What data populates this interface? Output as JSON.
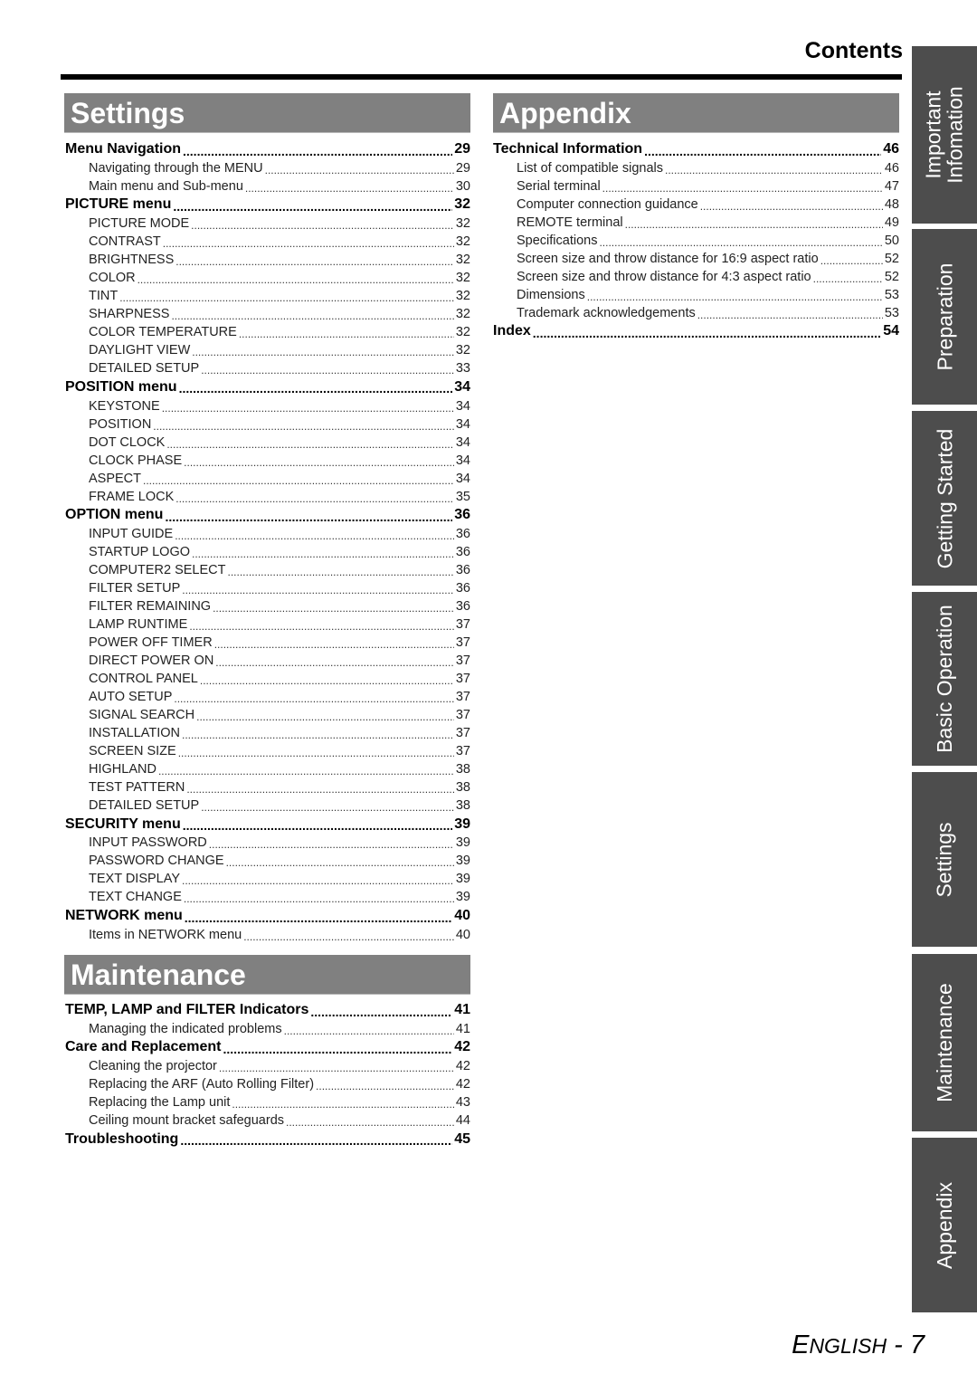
{
  "page": {
    "contents_title": "Contents",
    "footer_lang": "ENGLISH",
    "footer_lang_first": "E",
    "footer_lang_rest": "NGLISH",
    "footer_sep": " - ",
    "footer_page": "7"
  },
  "colors": {
    "section_header_bg": "#808080",
    "tab_bg": "#4d4d4d",
    "text": "#000000"
  },
  "settings": {
    "title": "Settings",
    "entries": [
      {
        "type": "main",
        "label": "Menu Navigation",
        "page": "29"
      },
      {
        "type": "sub",
        "label": "Navigating through the MENU",
        "page": "29"
      },
      {
        "type": "sub",
        "label": "Main menu and Sub-menu",
        "page": "30"
      },
      {
        "type": "main",
        "label": "PICTURE menu",
        "page": "32"
      },
      {
        "type": "sub",
        "label": "PICTURE MODE",
        "page": "32"
      },
      {
        "type": "sub",
        "label": "CONTRAST",
        "page": "32"
      },
      {
        "type": "sub",
        "label": "BRIGHTNESS",
        "page": "32"
      },
      {
        "type": "sub",
        "label": "COLOR",
        "page": "32"
      },
      {
        "type": "sub",
        "label": "TINT",
        "page": "32"
      },
      {
        "type": "sub",
        "label": "SHARPNESS",
        "page": "32"
      },
      {
        "type": "sub",
        "label": "COLOR TEMPERATURE",
        "page": "32"
      },
      {
        "type": "sub",
        "label": "DAYLIGHT VIEW",
        "page": "32"
      },
      {
        "type": "sub",
        "label": "DETAILED SETUP",
        "page": "33"
      },
      {
        "type": "main",
        "label": "POSITION menu",
        "page": "34"
      },
      {
        "type": "sub",
        "label": "KEYSTONE",
        "page": "34"
      },
      {
        "type": "sub",
        "label": "POSITION",
        "page": "34"
      },
      {
        "type": "sub",
        "label": "DOT CLOCK",
        "page": "34"
      },
      {
        "type": "sub",
        "label": "CLOCK PHASE",
        "page": "34"
      },
      {
        "type": "sub",
        "label": "ASPECT",
        "page": "34"
      },
      {
        "type": "sub",
        "label": "FRAME LOCK",
        "page": "35"
      },
      {
        "type": "main",
        "label": "OPTION menu",
        "page": "36"
      },
      {
        "type": "sub",
        "label": "INPUT GUIDE",
        "page": "36"
      },
      {
        "type": "sub",
        "label": "STARTUP LOGO",
        "page": "36"
      },
      {
        "type": "sub",
        "label": "COMPUTER2 SELECT",
        "page": "36"
      },
      {
        "type": "sub",
        "label": "FILTER SETUP",
        "page": "36"
      },
      {
        "type": "sub",
        "label": "FILTER REMAINING",
        "page": "36"
      },
      {
        "type": "sub",
        "label": "LAMP RUNTIME",
        "page": "37"
      },
      {
        "type": "sub",
        "label": "POWER OFF TIMER",
        "page": "37"
      },
      {
        "type": "sub",
        "label": "DIRECT POWER ON",
        "page": "37"
      },
      {
        "type": "sub",
        "label": "CONTROL PANEL",
        "page": "37"
      },
      {
        "type": "sub",
        "label": "AUTO SETUP",
        "page": "37"
      },
      {
        "type": "sub",
        "label": "SIGNAL SEARCH",
        "page": "37"
      },
      {
        "type": "sub",
        "label": "INSTALLATION",
        "page": "37"
      },
      {
        "type": "sub",
        "label": "SCREEN SIZE",
        "page": "37"
      },
      {
        "type": "sub",
        "label": "HIGHLAND",
        "page": "38"
      },
      {
        "type": "sub",
        "label": "TEST PATTERN",
        "page": "38"
      },
      {
        "type": "sub",
        "label": "DETAILED SETUP",
        "page": "38"
      },
      {
        "type": "main",
        "label": "SECURITY menu",
        "page": "39"
      },
      {
        "type": "sub",
        "label": "INPUT PASSWORD",
        "page": "39"
      },
      {
        "type": "sub",
        "label": "PASSWORD CHANGE",
        "page": "39"
      },
      {
        "type": "sub",
        "label": "TEXT DISPLAY",
        "page": "39"
      },
      {
        "type": "sub",
        "label": "TEXT CHANGE",
        "page": "39"
      },
      {
        "type": "main",
        "label": "NETWORK menu",
        "page": "40"
      },
      {
        "type": "sub",
        "label": "Items in NETWORK menu",
        "page": "40"
      }
    ]
  },
  "maintenance": {
    "title": "Maintenance",
    "entries": [
      {
        "type": "main",
        "label": "TEMP, LAMP and FILTER Indicators",
        "page": "41"
      },
      {
        "type": "sub",
        "label": "Managing the indicated problems",
        "page": "41"
      },
      {
        "type": "main",
        "label": "Care and Replacement",
        "page": "42"
      },
      {
        "type": "sub",
        "label": "Cleaning the projector",
        "page": "42"
      },
      {
        "type": "sub",
        "label": "Replacing the ARF (Auto Rolling Filter)",
        "page": "42"
      },
      {
        "type": "sub",
        "label": "Replacing the Lamp unit",
        "page": "43"
      },
      {
        "type": "sub",
        "label": "Ceiling mount bracket safeguards",
        "page": "44"
      },
      {
        "type": "main",
        "label": "Troubleshooting",
        "page": "45"
      }
    ]
  },
  "appendix": {
    "title": "Appendix",
    "entries": [
      {
        "type": "main",
        "label": "Technical Information",
        "page": "46"
      },
      {
        "type": "sub",
        "label": "List of compatible signals",
        "page": "46"
      },
      {
        "type": "sub",
        "label": "Serial terminal",
        "page": "47"
      },
      {
        "type": "sub",
        "label": "Computer connection guidance",
        "page": "48"
      },
      {
        "type": "sub",
        "label": "REMOTE terminal",
        "page": "49"
      },
      {
        "type": "sub",
        "label": "Specifications",
        "page": "50"
      },
      {
        "type": "sub",
        "label": "Screen size and throw distance for 16:9 aspect ratio",
        "page": "52"
      },
      {
        "type": "sub",
        "label": "Screen size and throw distance for 4:3 aspect ratio",
        "page": "52"
      },
      {
        "type": "sub",
        "label": "Dimensions",
        "page": "53"
      },
      {
        "type": "sub",
        "label": "Trademark acknowledgements",
        "page": "53"
      },
      {
        "type": "main",
        "label": "Index",
        "page": "54"
      }
    ]
  },
  "side_tabs": [
    {
      "label_line1": "Important",
      "label_line2": "Infomation"
    },
    {
      "label_line1": "Preparation",
      "label_line2": ""
    },
    {
      "label_line1": "Getting Started",
      "label_line2": ""
    },
    {
      "label_line1": "Basic Operation",
      "label_line2": ""
    },
    {
      "label_line1": "Settings",
      "label_line2": ""
    },
    {
      "label_line1": "Maintenance",
      "label_line2": ""
    },
    {
      "label_line1": "Appendix",
      "label_line2": ""
    }
  ]
}
